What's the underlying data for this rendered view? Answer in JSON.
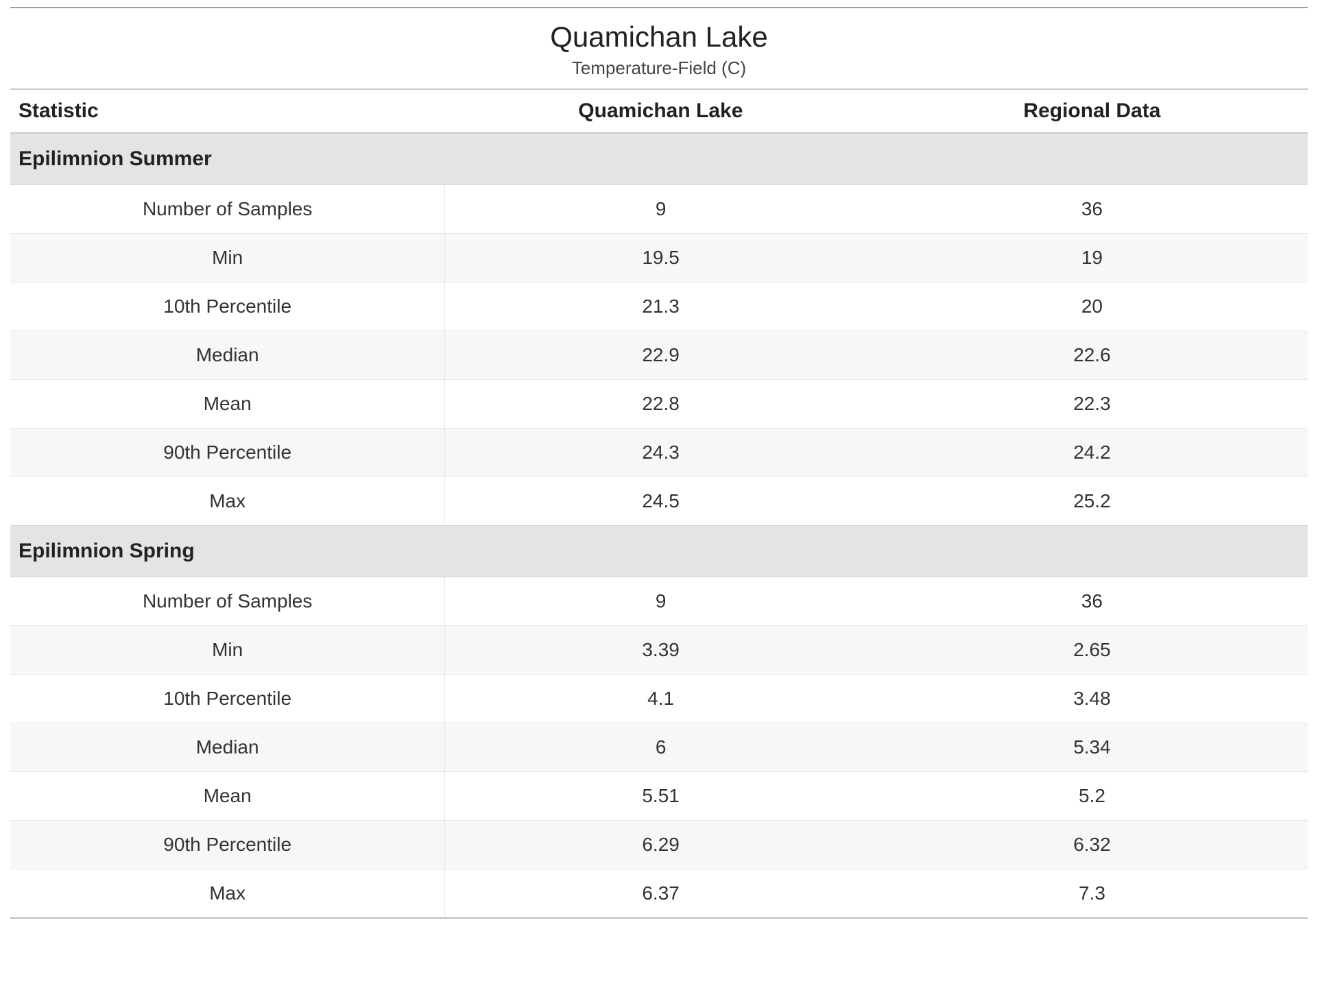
{
  "chart_data": {
    "type": "table",
    "title": "Quamichan Lake",
    "subtitle": "Temperature-Field (C)",
    "columns": [
      "Statistic",
      "Quamichan Lake",
      "Regional Data"
    ],
    "sections": [
      {
        "name": "Epilimnion Summer",
        "rows": [
          {
            "stat": "Number of Samples",
            "q": "9",
            "r": "36"
          },
          {
            "stat": "Min",
            "q": "19.5",
            "r": "19"
          },
          {
            "stat": "10th Percentile",
            "q": "21.3",
            "r": "20"
          },
          {
            "stat": "Median",
            "q": "22.9",
            "r": "22.6"
          },
          {
            "stat": "Mean",
            "q": "22.8",
            "r": "22.3"
          },
          {
            "stat": "90th Percentile",
            "q": "24.3",
            "r": "24.2"
          },
          {
            "stat": "Max",
            "q": "24.5",
            "r": "25.2"
          }
        ]
      },
      {
        "name": "Epilimnion Spring",
        "rows": [
          {
            "stat": "Number of Samples",
            "q": "9",
            "r": "36"
          },
          {
            "stat": "Min",
            "q": "3.39",
            "r": "2.65"
          },
          {
            "stat": "10th Percentile",
            "q": "4.1",
            "r": "3.48"
          },
          {
            "stat": "Median",
            "q": "6",
            "r": "5.34"
          },
          {
            "stat": "Mean",
            "q": "5.51",
            "r": "5.2"
          },
          {
            "stat": "90th Percentile",
            "q": "6.29",
            "r": "6.32"
          },
          {
            "stat": "Max",
            "q": "6.37",
            "r": "7.3"
          }
        ]
      }
    ]
  }
}
